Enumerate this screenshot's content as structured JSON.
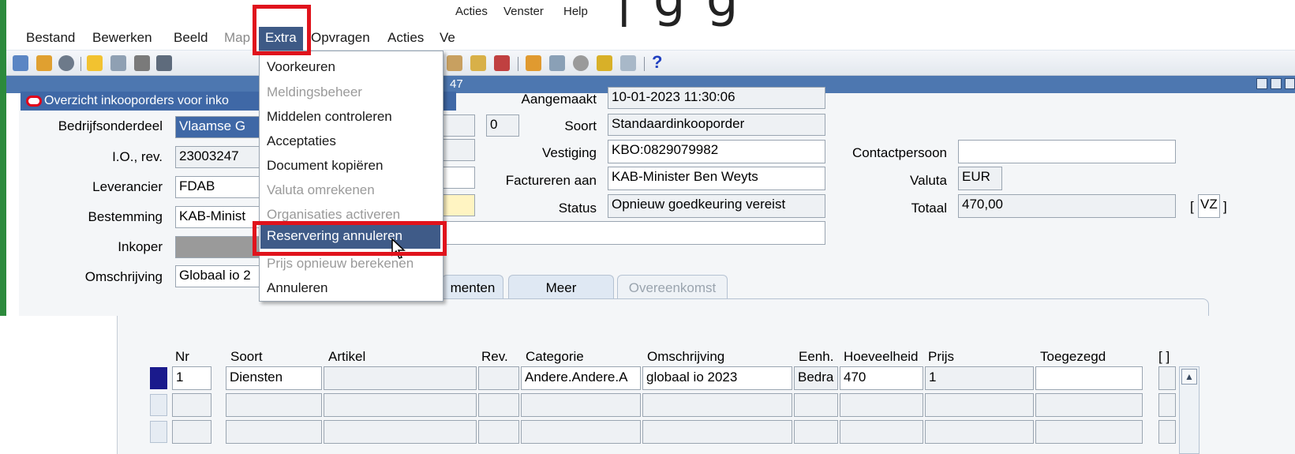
{
  "top_menu": [
    "Acties",
    "Venster",
    "Help"
  ],
  "heading_fragment": "| g g",
  "menubar": {
    "items": [
      "Bestand",
      "Bewerken",
      "Beeld",
      "Map",
      "Extra",
      "Opvragen",
      "Acties",
      "Ve"
    ]
  },
  "toolbar": {
    "help": "?"
  },
  "window": {
    "title_fragment": "47"
  },
  "subwindow": {
    "title": "Overzicht inkooporders voor inko"
  },
  "form": {
    "bedrijfsonderdeel_label": "Bedrijfsonderdeel",
    "bedrijfsonderdeel_value": "Vlaamse G",
    "io_label": "I.O., rev.",
    "io_value": "23003247",
    "rev_value": "0",
    "leverancier_label": "Leverancier",
    "leverancier_value": "FDAB",
    "bestemming_label": "Bestemming",
    "bestemming_value": "KAB-Minist",
    "inkoper_label": "Inkoper",
    "inkoper_value": "",
    "omschrijving_label": "Omschrijving",
    "omschrijving_value": "Globaal io 2",
    "aangemaakt_label": "Aangemaakt",
    "aangemaakt_value": "10-01-2023 11:30:06",
    "soort_label": "Soort",
    "soort_value": "Standaardinkooporder",
    "vestiging_label": "Vestiging",
    "vestiging_value": "KBO:0829079982",
    "factureren_label": "Factureren aan",
    "factureren_value": "KAB-Minister Ben Weyts",
    "status_label": "Status",
    "status_value": "Opnieuw goedkeuring vereist",
    "contact_label": "Contactpersoon",
    "contact_value": "",
    "valuta_label": "Valuta",
    "valuta_value": "EUR",
    "totaal_label": "Totaal",
    "totaal_value": "470,00",
    "vz_value": "VZ",
    "bracket_open": "[",
    "bracket_close": "]"
  },
  "dropdown": {
    "items": [
      {
        "label": "Voorkeuren",
        "enabled": true
      },
      {
        "label": "Meldingsbeheer",
        "enabled": false
      },
      {
        "label": "Middelen controleren",
        "enabled": true
      },
      {
        "label": "Acceptaties",
        "enabled": true
      },
      {
        "label": "Document kopiëren",
        "enabled": true
      },
      {
        "label": "Valuta omrekenen",
        "enabled": false
      },
      {
        "label": "Organisaties activeren",
        "enabled": false
      },
      {
        "label": "Reservering annuleren",
        "enabled": true,
        "highlighted": true
      },
      {
        "label": "Prijs opnieuw berekenen",
        "enabled": false
      },
      {
        "label": "Annuleren",
        "enabled": true
      }
    ]
  },
  "tabs": [
    {
      "label": "menten",
      "enabled": true
    },
    {
      "label": "Meer",
      "enabled": true
    },
    {
      "label": "Overeenkomst",
      "enabled": false
    }
  ],
  "table": {
    "headers": [
      "Nr",
      "Soort",
      "Artikel",
      "Rev.",
      "Categorie",
      "Omschrijving",
      "Eenh.",
      "Hoeveelheid",
      "Prijs",
      "Toegezegd",
      "[ ]"
    ],
    "rows": [
      [
        "1",
        "Diensten",
        "",
        "",
        "Andere.Andere.A",
        "globaal io 2023",
        "Bedra",
        "470",
        "1",
        ""
      ]
    ]
  },
  "colors": {
    "accent": "#3f68a6",
    "highlight_box": "#e0131c",
    "menu_active": "#3e5a86"
  }
}
